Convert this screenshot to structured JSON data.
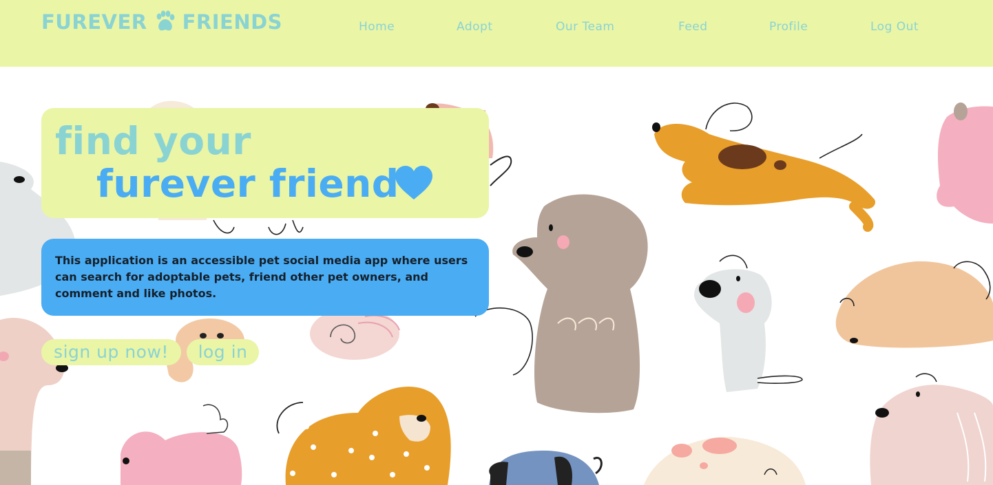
{
  "header": {
    "logo_left": "FUREVER",
    "logo_right": "FRIENDS",
    "logo_icon": "paw-icon",
    "nav": [
      {
        "label": "Home"
      },
      {
        "label": "Adopt"
      },
      {
        "label": "Our Team"
      },
      {
        "label": "Feed"
      },
      {
        "label": "Profile"
      },
      {
        "label": "Log Out"
      }
    ]
  },
  "hero": {
    "title_line1": "find your",
    "title_line2": "furever friend",
    "heart_icon": "heart-icon",
    "description": "This application is an accessible pet social media app where users can search for adoptable pets, friend other pet owners, and comment and like photos."
  },
  "actions": {
    "signup_label": "sign up now!",
    "login_label": "log in"
  },
  "colors": {
    "header_bg": "#eaf5a6",
    "teal_text": "#8ad3d3",
    "accent_blue": "#4aacf3",
    "dark_text": "#15202b"
  }
}
